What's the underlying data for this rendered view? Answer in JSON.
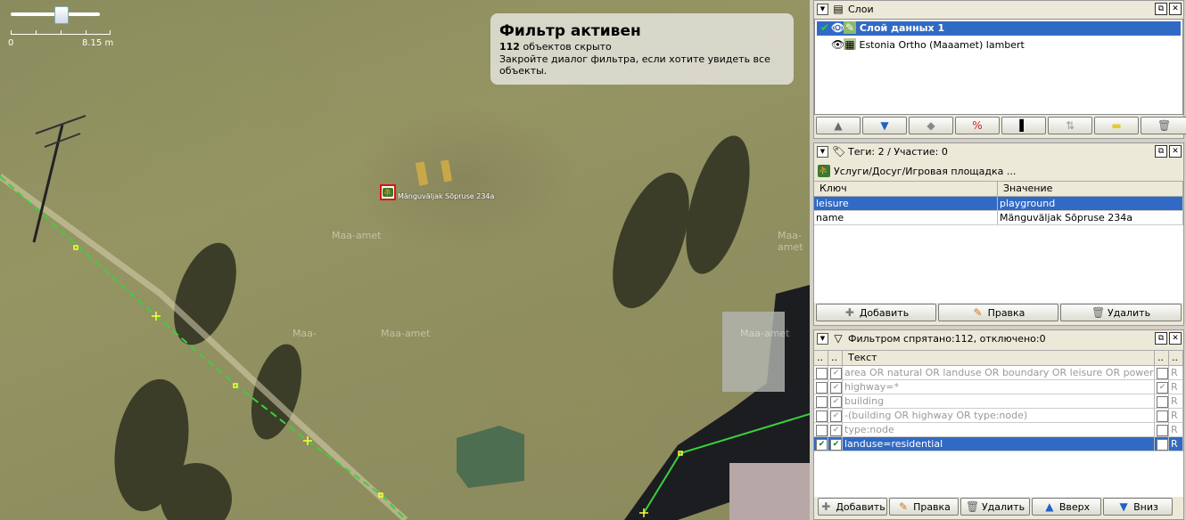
{
  "map": {
    "scale": {
      "start": "0",
      "end": "8.15 m"
    },
    "watermarks": [
      "Maa-amet",
      "Maa-amet",
      "Maa-",
      "Maa-amet",
      "Maa-amet"
    ],
    "poi_label": "Mänguväljak Sõpruse 234a",
    "filter_banner": {
      "title": "Фильтр активен",
      "hidden_count": "112",
      "hidden_suffix": " объектов скрыто",
      "hint": "Закройте диалог фильтра, если хотите увидеть все объекты."
    }
  },
  "layers_panel": {
    "title": "Слои",
    "layers": [
      {
        "name": "Слой данных 1",
        "active": true,
        "selected": true
      },
      {
        "name": "Estonia Ortho (Maaamet) lambert",
        "active": false,
        "selected": false
      }
    ],
    "buttons": [
      "move-up",
      "move-down",
      "merge",
      "delete-layer-active",
      "toggle-opacity",
      "move-to-bottom",
      "activate",
      "delete"
    ]
  },
  "tags_panel": {
    "title": "Теги: 2 / Участие: 0",
    "preset": "Услуги/Досуг/Игровая площадка ...",
    "columns": {
      "key": "Ключ",
      "value": "Значение"
    },
    "rows": [
      {
        "key": "leisure",
        "value": "playground",
        "selected": true
      },
      {
        "key": "name",
        "value": "Mänguväljak Sõpruse 234a",
        "selected": false
      }
    ],
    "buttons": {
      "add": "Добавить",
      "edit": "Правка",
      "delete": "Удалить"
    }
  },
  "filter_panel": {
    "title": "Фильтром спрятано:112, отключено:0",
    "columns": {
      "c1": "..",
      "c2": "..",
      "text": "Текст",
      "c4": "..",
      "c5": ".."
    },
    "rows": [
      {
        "enabled": false,
        "hiding": true,
        "text": "area OR natural OR landuse OR boundary OR leisure OR power",
        "inverted": false,
        "r": "R",
        "selected": false
      },
      {
        "enabled": false,
        "hiding": true,
        "text": "highway=*",
        "inverted": true,
        "r": "R",
        "selected": false
      },
      {
        "enabled": false,
        "hiding": true,
        "text": "building",
        "inverted": false,
        "r": "R",
        "selected": false
      },
      {
        "enabled": false,
        "hiding": true,
        "text": "-(building OR highway OR type:node)",
        "inverted": false,
        "r": "R",
        "selected": false
      },
      {
        "enabled": false,
        "hiding": true,
        "text": "type:node",
        "inverted": false,
        "r": "R",
        "selected": false
      },
      {
        "enabled": true,
        "hiding": true,
        "text": "landuse=residential",
        "inverted": false,
        "r": "R",
        "selected": true
      }
    ],
    "buttons": {
      "add": "Добавить",
      "edit": "Правка",
      "delete": "Удалить",
      "up": "Вверх",
      "down": "Вниз"
    }
  }
}
